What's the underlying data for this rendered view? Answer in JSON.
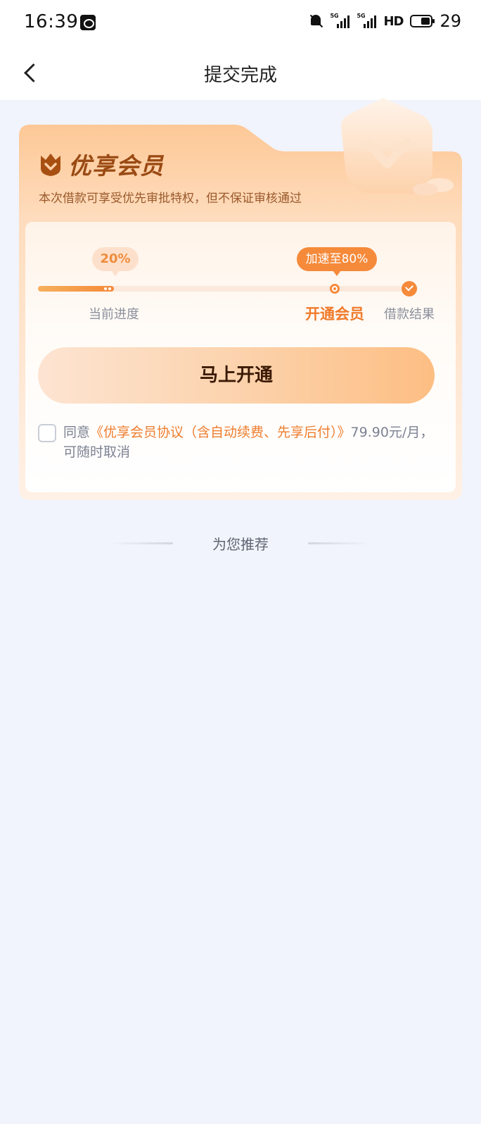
{
  "status_bar": {
    "time": "16:39",
    "signal_1_label": "5G",
    "signal_2_label": "5G",
    "network_label": "HD",
    "battery_level": "29",
    "icons": [
      "weibo-icon",
      "bell-off-icon",
      "signal-icon",
      "battery-icon"
    ]
  },
  "nav": {
    "title": "提交完成"
  },
  "member_card": {
    "title": "优享会员",
    "subtitle": "本次借款可享受优先审批特权，但不保证审核通过",
    "progress": {
      "current_bubble": "20%",
      "speed_bubble": "加速至80%",
      "current_fraction": 0.2,
      "steps": {
        "current": "当前进度",
        "member": "开通会员",
        "result": "借款结果"
      }
    },
    "open_button": "马上开通",
    "agreement": {
      "prefix": "同意",
      "link": "《优享会员协议（含自动续费、先享后付）》",
      "suffix": "79.90元/月，可随时取消",
      "checked": false
    }
  },
  "recommend": {
    "title": "为您推荐"
  },
  "colors": {
    "accent": "#f58a3a",
    "card_gradient_top": "#fdcf9f",
    "page_bg": "#f1f4fc"
  }
}
